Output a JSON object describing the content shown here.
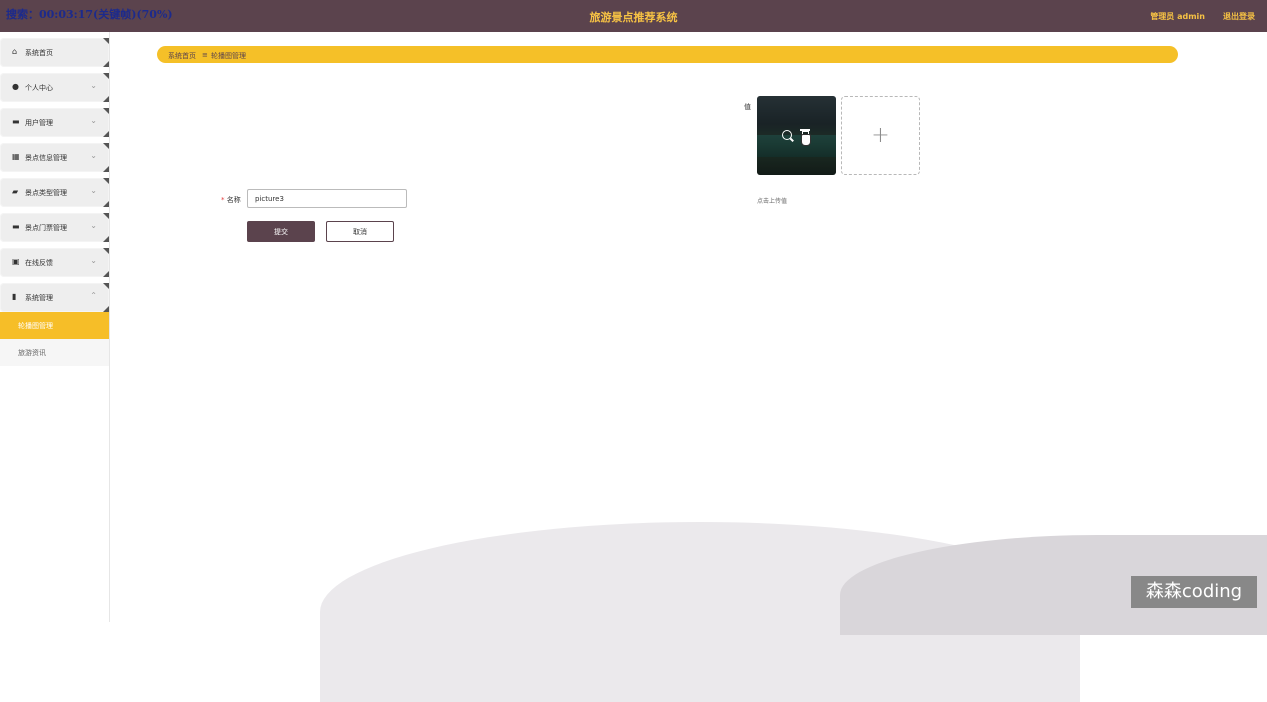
{
  "overlay_text": "搜索：00:03:17(关键帧)(70%)",
  "header": {
    "title": "旅游景点推荐系统",
    "user": "管理员 admin",
    "logout": "退出登录"
  },
  "sidebar": {
    "items": [
      {
        "label": "系统首页",
        "icon": "home-icon"
      },
      {
        "label": "个人中心",
        "icon": "user-icon"
      },
      {
        "label": "用户管理",
        "icon": "users-icon"
      },
      {
        "label": "景点信息管理",
        "icon": "grid-icon"
      },
      {
        "label": "景点类型管理",
        "icon": "briefcase-icon"
      },
      {
        "label": "景点门票管理",
        "icon": "ticket-icon"
      },
      {
        "label": "在线反馈",
        "icon": "clipboard-icon"
      },
      {
        "label": "系统管理",
        "icon": "chart-icon"
      }
    ],
    "sub_items": [
      {
        "label": "轮播图管理",
        "active": true
      },
      {
        "label": "旅游资讯",
        "active": false
      }
    ]
  },
  "breadcrumb": {
    "home": "系统首页",
    "separator": "≡",
    "current": "轮播图管理"
  },
  "form": {
    "name_label": "名称",
    "name_value": "picture3",
    "value_label": "值",
    "upload_hint": "点击上传值",
    "submit": "提交",
    "cancel": "取消"
  },
  "watermark": "森森coding",
  "colors": {
    "header_bg": "#5b434d",
    "accent": "#f5c028",
    "header_text": "#f6c244"
  }
}
